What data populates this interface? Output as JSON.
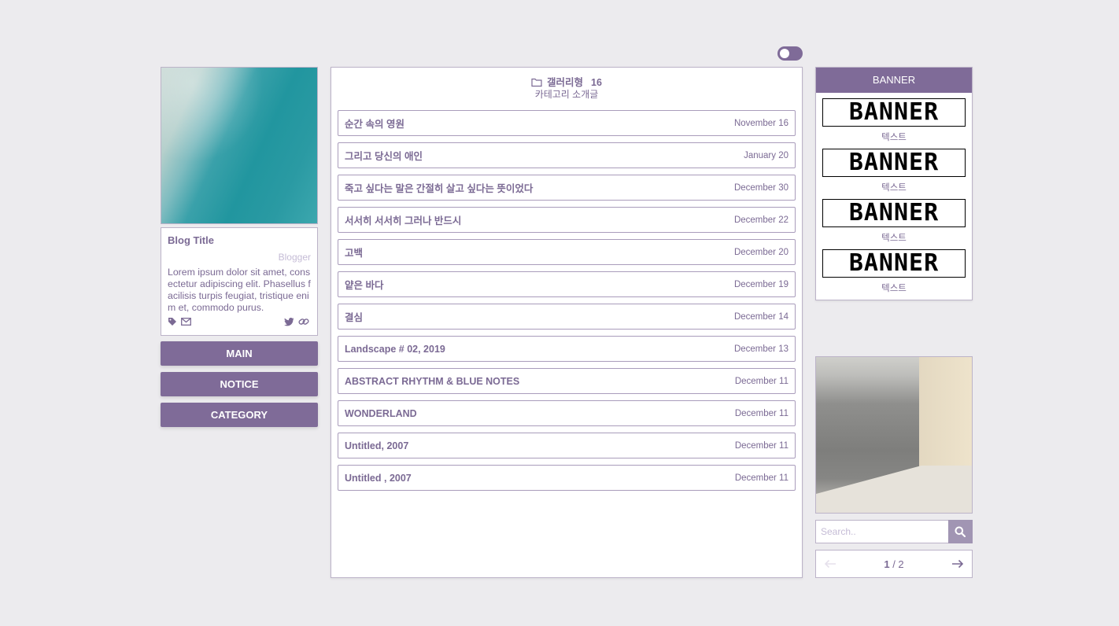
{
  "profile": {
    "title": "Blog Title",
    "blogger": "Blogger",
    "description": "Lorem ipsum dolor sit amet, consectetur adipiscing elit. Phasellus facilisis turpis feugiat, tristique enim et, commodo purus."
  },
  "nav": [
    "MAIN",
    "NOTICE",
    "CATEGORY"
  ],
  "category": {
    "name": "갤러리형",
    "count": "16",
    "description": "카테고리 소개글"
  },
  "posts": [
    {
      "title": "순간 속의 영원",
      "date": "November 16"
    },
    {
      "title": "그리고 당신의 애인",
      "date": "January 20"
    },
    {
      "title": "죽고 싶다는 말은 간절히 살고 싶다는 뜻이었다",
      "date": "December 30"
    },
    {
      "title": "서서히 서서히 그러나 반드시",
      "date": "December 22"
    },
    {
      "title": "고백",
      "date": "December 20"
    },
    {
      "title": "얕은 바다",
      "date": "December 19"
    },
    {
      "title": "결심",
      "date": "December 14"
    },
    {
      "title": "Landscape # 02, 2019",
      "date": "December 13"
    },
    {
      "title": "ABSTRACT RHYTHM & BLUE NOTES",
      "date": "December 11"
    },
    {
      "title": "WONDERLAND",
      "date": "December 11"
    },
    {
      "title": "Untitled, 2007",
      "date": "December 11"
    },
    {
      "title": "Untitled , 2007",
      "date": "December 11"
    }
  ],
  "banner": {
    "header": "BANNER",
    "items": [
      {
        "image_text": "BANNER",
        "caption": "텍스트"
      },
      {
        "image_text": "BANNER",
        "caption": "텍스트"
      },
      {
        "image_text": "BANNER",
        "caption": "텍스트"
      },
      {
        "image_text": "BANNER",
        "caption": "텍스트"
      }
    ]
  },
  "search": {
    "placeholder": "Search.."
  },
  "pager": {
    "current": "1",
    "sep_total": " / 2"
  },
  "colors": {
    "accent": "#7f6b98",
    "background": "#ecebee",
    "text": "#7b6a94"
  }
}
